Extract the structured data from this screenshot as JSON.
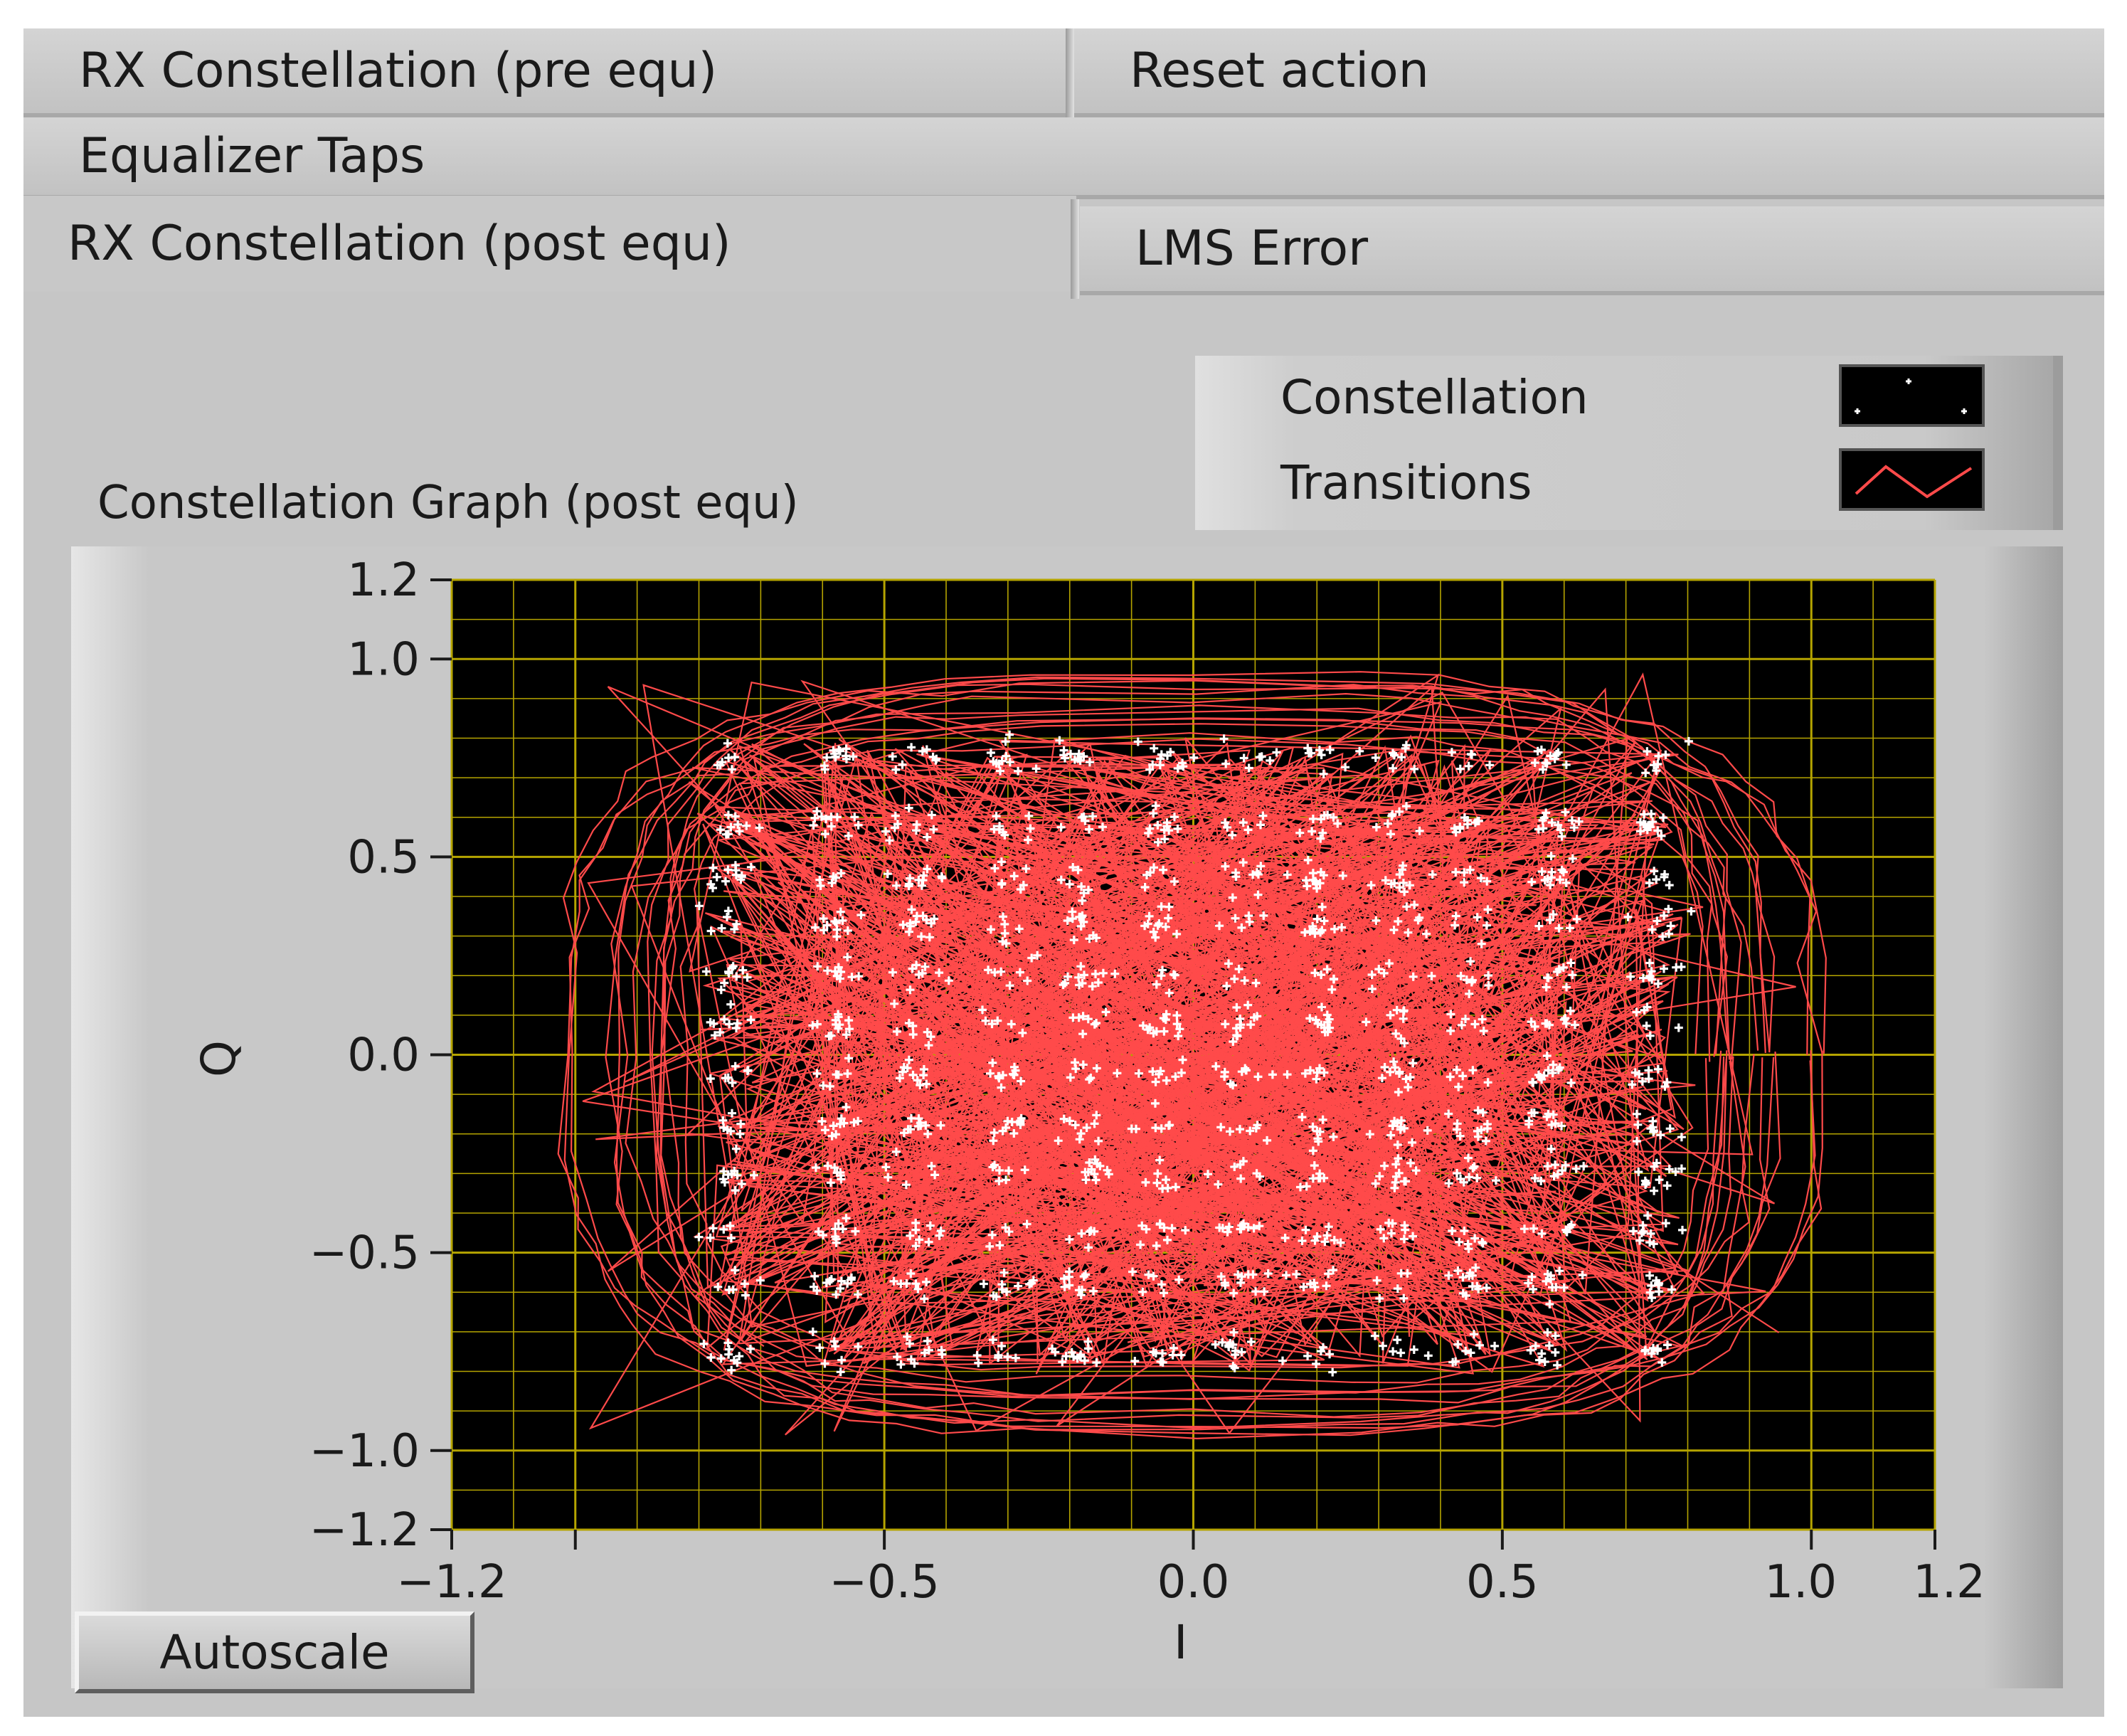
{
  "tabs": [
    {
      "label": "RX Constellation (pre equ)",
      "active": false
    },
    {
      "label": "Reset action",
      "active": false
    },
    {
      "label": "Equalizer Taps",
      "active": false
    },
    {
      "label": "RX Constellation (post equ)",
      "active": true
    },
    {
      "label": "LMS Error",
      "active": false
    }
  ],
  "graph": {
    "title": "Constellation Graph (post equ)",
    "legend": [
      {
        "name": "Constellation",
        "icon": "constellation-swatch-icon"
      },
      {
        "name": "Transitions",
        "icon": "transitions-swatch-icon"
      }
    ],
    "autoscale_label": "Autoscale",
    "colors": {
      "plot_background": "#000000",
      "grid": "#b5a400",
      "constellation": "#ffffff",
      "transitions": "#ff4a4a"
    }
  },
  "chart_data": {
    "type": "scatter",
    "xlabel": "I",
    "ylabel": "Q",
    "xlim": [
      -1.2,
      1.2
    ],
    "ylim": [
      -1.2,
      1.2
    ],
    "xticks": [
      "−1.2",
      "−0.5",
      "0.0",
      "0.5",
      "1.0",
      "1.2"
    ],
    "yticks": [
      "1.2",
      "1.0",
      "0.5",
      "0.0",
      "−0.5",
      "−1.0",
      "−1.2"
    ],
    "grid": true,
    "legend_position": "top-right",
    "series": [
      {
        "name": "Constellation",
        "marker": "plus",
        "description_levels": [
          -0.75,
          -0.45,
          -0.25,
          -0.05,
          0.05,
          0.25,
          0.45,
          0.75
        ],
        "note_levels": "16x16 grid of symbol clusters between -0.8 and 0.8 on both axes"
      },
      {
        "name": "Transitions",
        "marker": "line"
      }
    ]
  }
}
